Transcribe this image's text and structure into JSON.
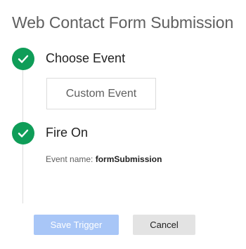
{
  "title": "Web Contact Form Submission",
  "steps": [
    {
      "label": "Choose Event",
      "icon": "check-circle-icon"
    },
    {
      "label": "Fire On",
      "icon": "check-circle-icon"
    }
  ],
  "event_option": "Custom Event",
  "event_name": {
    "label": "Event name:",
    "value": "formSubmission"
  },
  "buttons": {
    "save_label": "Save Trigger",
    "cancel_label": "Cancel"
  },
  "colors": {
    "check": "#0f9d58",
    "save_disabled": "#a8c6f7",
    "cancel": "#e3e3e3"
  }
}
